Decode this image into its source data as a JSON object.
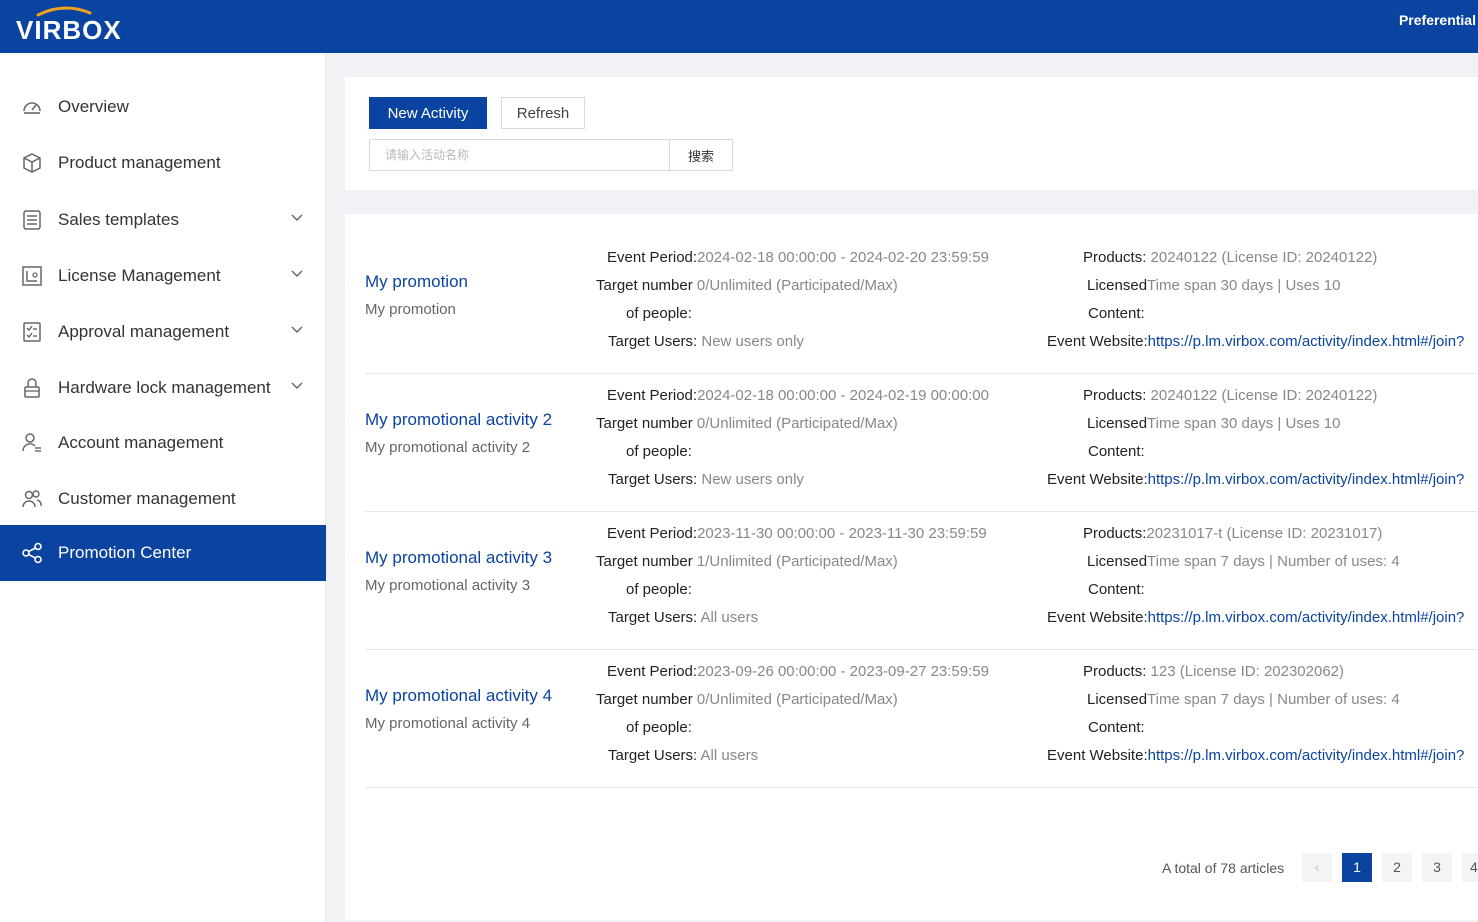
{
  "brand": {
    "logo_text": "VIRBOX",
    "primary_color": "#0b44a0"
  },
  "header": {
    "right_text": "Preferential"
  },
  "sidebar": {
    "items": [
      {
        "label": "Overview",
        "icon": "dashboard-icon",
        "has_submenu": false,
        "active": false
      },
      {
        "label": "Product management",
        "icon": "cube-icon",
        "has_submenu": false,
        "active": false
      },
      {
        "label": "Sales templates",
        "icon": "list-icon",
        "has_submenu": true,
        "active": false
      },
      {
        "label": "License Management",
        "icon": "license-icon",
        "has_submenu": true,
        "active": false
      },
      {
        "label": "Approval management",
        "icon": "approval-icon",
        "has_submenu": true,
        "active": false
      },
      {
        "label": "Hardware lock management",
        "icon": "lock-icon",
        "has_submenu": true,
        "active": false
      },
      {
        "label": "Account management",
        "icon": "user-list-icon",
        "has_submenu": false,
        "active": false
      },
      {
        "label": "Customer management",
        "icon": "users-icon",
        "has_submenu": false,
        "active": false
      },
      {
        "label": "Promotion Center",
        "icon": "share-icon",
        "has_submenu": false,
        "active": true
      }
    ]
  },
  "toolbar": {
    "new_label": "New Activity",
    "refresh_label": "Refresh",
    "search_placeholder": "请输入活动名称",
    "search_value": "",
    "search_button": "搜索"
  },
  "labels": {
    "event_period": "Event Period:",
    "target_number_1": "Target number",
    "target_number_2": "of people:",
    "target_users": "Target Users:",
    "products": "Products:",
    "licensed": "Licensed",
    "content": "Content:",
    "event_website": "Event Website:"
  },
  "activities": [
    {
      "title": "My promotion",
      "subtitle": "My promotion",
      "period": "2024-02-18 00:00:00 - 2024-02-20 23:59:59",
      "target_number": "0/Unlimited (Participated/Max)",
      "target_users": "New users only",
      "products": "20240122 (License ID: 20240122)",
      "licensed": "Time span 30 days | Uses 10",
      "content": "",
      "website": "https://p.lm.virbox.com/activity/index.html#/join?"
    },
    {
      "title": "My promotional activity 2",
      "subtitle": "My promotional activity 2",
      "period": "2024-02-18 00:00:00 - 2024-02-19 00:00:00",
      "target_number": "0/Unlimited (Participated/Max)",
      "target_users": "New users only",
      "products": "20240122 (License ID: 20240122)",
      "licensed": "Time span 30 days | Uses 10",
      "content": "",
      "website": "https://p.lm.virbox.com/activity/index.html#/join?"
    },
    {
      "title": "My promotional activity 3",
      "subtitle": "My promotional activity 3",
      "period": "2023-11-30 00:00:00 - 2023-11-30 23:59:59",
      "target_number": "1/Unlimited (Participated/Max)",
      "target_users": "All users",
      "products": "20231017-t (License ID: 20231017)",
      "licensed": "Time span 7 days | Number of uses: 4",
      "content": "",
      "website": "https://p.lm.virbox.com/activity/index.html#/join?"
    },
    {
      "title": "My promotional activity 4",
      "subtitle": "My promotional activity 4",
      "period": "2023-09-26 00:00:00 - 2023-09-27 23:59:59",
      "target_number": "0/Unlimited (Participated/Max)",
      "target_users": "All users",
      "products": "123 (License ID: 202302062)",
      "licensed": "Time span 7 days | Number of uses: 4",
      "content": "",
      "website": "https://p.lm.virbox.com/activity/index.html#/join?"
    }
  ],
  "pagination": {
    "total_text": "A total of 78 articles",
    "prev": "‹",
    "pages": [
      "1",
      "2",
      "3",
      "4"
    ],
    "current": "1"
  }
}
